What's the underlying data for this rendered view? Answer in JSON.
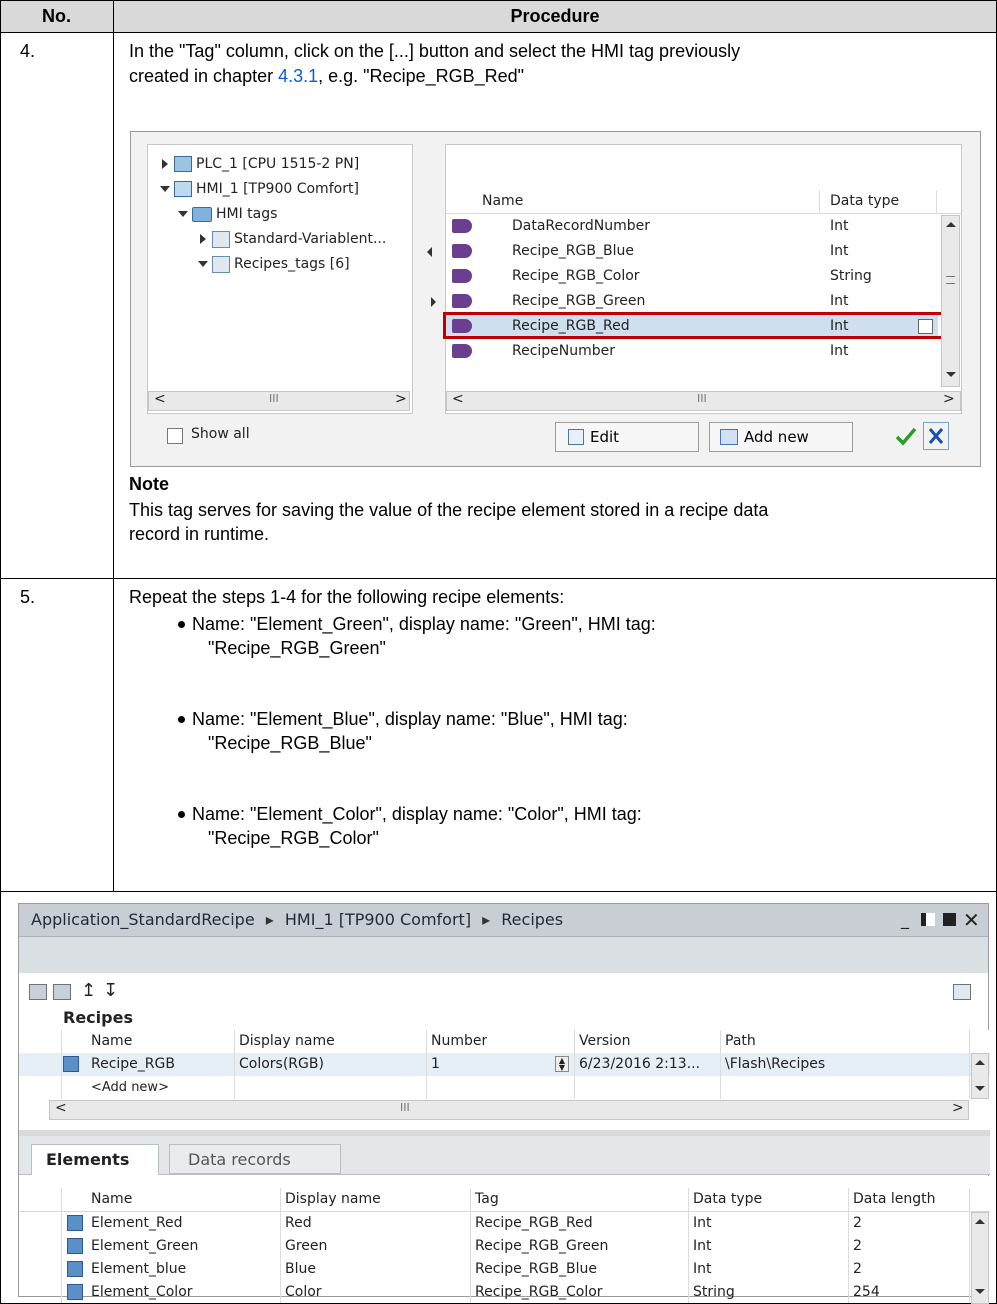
{
  "table": {
    "col_no": "No.",
    "col_procedure": "Procedure"
  },
  "step4": {
    "number": "4.",
    "text_line1": "In the \"Tag\" column, click on the [...] button and select the HMI tag previously",
    "text_line2_pre": "created in chapter ",
    "text_line2_link": "4.3.1",
    "text_line2_post": ", e.g. \"Recipe_RGB_Red\"",
    "note_title": "Note",
    "note_line1": "This tag serves for saving the value of the recipe element stored in a recipe data",
    "note_line2": "record in runtime."
  },
  "picker": {
    "tree": [
      {
        "label": "PLC_1 [CPU 1515-2 PN]",
        "expanded": false
      },
      {
        "label": "HMI_1 [TP900 Comfort]",
        "expanded": true
      },
      {
        "label": "HMI tags",
        "expanded": true
      },
      {
        "label": "Standard-Variablent...",
        "expanded": false
      },
      {
        "label": "Recipes_tags [6]",
        "expanded": true
      }
    ],
    "search_value": "",
    "columns": {
      "name": "Name",
      "data_type": "Data type"
    },
    "rows": [
      {
        "name": "DataRecordNumber",
        "type": "Int"
      },
      {
        "name": "Recipe_RGB_Blue",
        "type": "Int"
      },
      {
        "name": "Recipe_RGB_Color",
        "type": "String"
      },
      {
        "name": "Recipe_RGB_Green",
        "type": "Int"
      },
      {
        "name": "Recipe_RGB_Red",
        "type": "Int"
      },
      {
        "name": "RecipeNumber",
        "type": "Int"
      }
    ],
    "selected_row": "Recipe_RGB_Red",
    "highlight_color": "#c00000",
    "show_all_label": "Show all",
    "edit_label": "Edit",
    "add_new_label": "Add new",
    "scroll_mark": "III"
  },
  "step5": {
    "number": "5.",
    "intro": "Repeat the steps 1-4 for the following recipe elements:",
    "bullets": [
      {
        "line1": "Name: \"Element_Green\", display name: \"Green\", HMI tag:",
        "line2": "\"Recipe_RGB_Green\""
      },
      {
        "line1": "Name: \"Element_Blue\", display name: \"Blue\", HMI tag:",
        "line2": "\"Recipe_RGB_Blue\""
      },
      {
        "line1": "Name: \"Element_Color\", display name: \"Color\", HMI tag:",
        "line2": "\"Recipe_RGB_Color\""
      }
    ]
  },
  "editor": {
    "breadcrumb": [
      "Application_StandardRecipe",
      "HMI_1 [TP900 Comfort]",
      "Recipes"
    ],
    "recipes_title": "Recipes",
    "recipe_columns": [
      "Name",
      "Display name",
      "Number",
      "Version",
      "Path"
    ],
    "recipe_rows": [
      {
        "name": "Recipe_RGB",
        "display": "Colors(RGB)",
        "number": "1",
        "version": "6/23/2016 2:13...",
        "path": "\\Flash\\Recipes"
      }
    ],
    "add_new": "<Add new>",
    "tabs": [
      "Elements",
      "Data records"
    ],
    "element_columns": [
      "Name",
      "Display name",
      "Tag",
      "Data type",
      "Data length"
    ],
    "element_rows": [
      {
        "name": "Element_Red",
        "display": "Red",
        "tag": "Recipe_RGB_Red",
        "type": "Int",
        "length": "2"
      },
      {
        "name": "Element_Green",
        "display": "Green",
        "tag": "Recipe_RGB_Green",
        "type": "Int",
        "length": "2"
      },
      {
        "name": "Element_blue",
        "display": "Blue",
        "tag": "Recipe_RGB_Blue",
        "type": "Int",
        "length": "2"
      },
      {
        "name": "Element_Color",
        "display": "Color",
        "tag": "Recipe_RGB_Color",
        "type": "String",
        "length": "254"
      }
    ],
    "scroll_mark": "III"
  }
}
